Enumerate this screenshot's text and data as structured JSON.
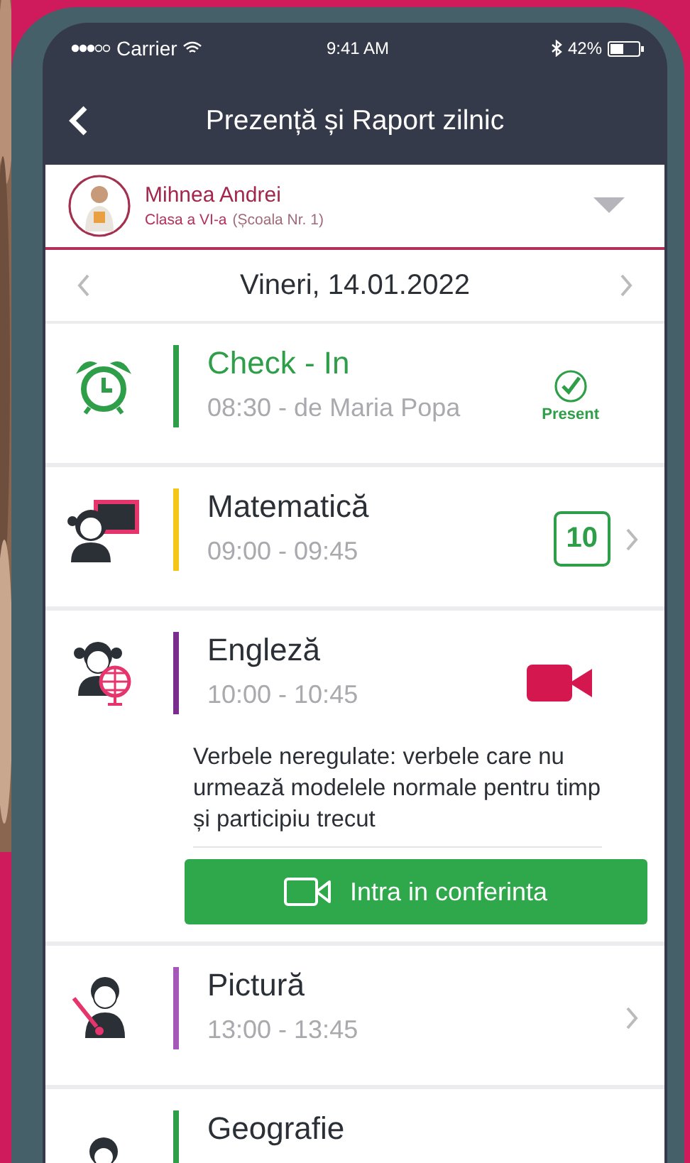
{
  "status_bar": {
    "carrier": "Carrier",
    "time": "9:41 AM",
    "battery": "42%"
  },
  "header": {
    "title": "Prezență și Raport zilnic"
  },
  "student": {
    "name": "Mihnea Andrei",
    "class": "Clasa a VI-a",
    "school": "(Școala Nr. 1)"
  },
  "date": "Vineri, 14.01.2022",
  "entries": [
    {
      "kind": "checkin",
      "color": "#2e9e48",
      "title": "Check - In",
      "subtitle": "08:30 - de Maria Popa",
      "status": "Present"
    },
    {
      "kind": "lesson",
      "color": "#f5c518",
      "title": "Matematică",
      "subtitle": "09:00 - 09:45",
      "grade": "10",
      "chevron": true
    },
    {
      "kind": "lesson",
      "color": "#7b2d8e",
      "title": "Engleză",
      "subtitle": "10:00 - 10:45",
      "video": true,
      "note": "Verbele neregulate: verbele care nu urmează modelele normale pentru timp și participiu trecut",
      "button": "Intra in conferinta"
    },
    {
      "kind": "lesson",
      "color": "#a558b8",
      "title": "Pictură",
      "subtitle": "13:00 - 13:45",
      "chevron": true
    },
    {
      "kind": "lesson",
      "color": "#2e9e48",
      "title": "Geografie"
    }
  ]
}
